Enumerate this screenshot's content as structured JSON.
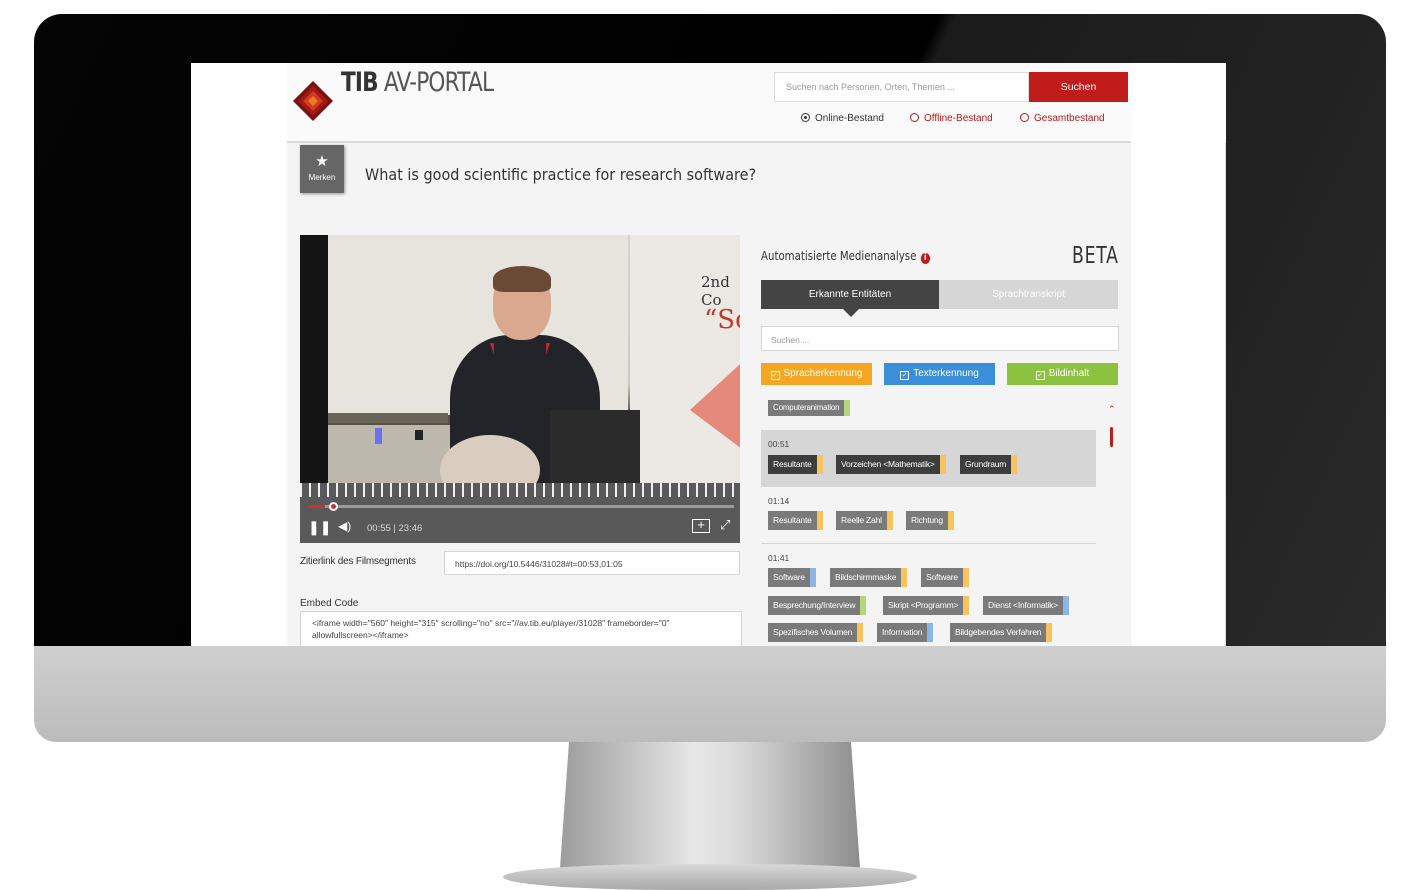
{
  "header": {
    "logo_bold": "TIB",
    "logo_light": "AV-PORTAL",
    "search_placeholder": "Suchen nach Personen, Orten, Themen ...",
    "search_button": "Suchen",
    "scope": [
      "Online-Bestand",
      "Offline-Bestand",
      "Gesamtbestand"
    ],
    "scope_selected": "Online-Bestand"
  },
  "merken": "Merken",
  "title": "What is good scientific practice for research software?",
  "video": {
    "slide_line1": "2nd Co",
    "slide_line2": "“So",
    "time": "00:55 | 23:46",
    "progress": 0.04
  },
  "cite": {
    "label": "Zitierlink des Filmsegments",
    "value": "https://doi.org/10.5446/31028#t=00:53,01:05"
  },
  "embed": {
    "label": "Embed Code",
    "line1": "<iframe width=\"560\" height=\"315\" scrolling=\"no\" src=\"//av.tib.eu/player/31028\" frameborder=\"0\"",
    "line2": "allowfullscreen></iframe>"
  },
  "analysis": {
    "title": "Automatisierte Medienanalyse",
    "badge": "BETA",
    "tabs": [
      "Erkannte Entitäten",
      "Sprachtranskript"
    ],
    "search_placeholder": "Suchen ...",
    "filters": [
      {
        "label": "Spracherkennung",
        "color": "#f5a623"
      },
      {
        "label": "Texterkennung",
        "color": "#3b8fd8"
      },
      {
        "label": "Bildinhalt",
        "color": "#8cc23f"
      }
    ],
    "colors": {
      "speech": "#f6c35c",
      "text": "#8ab6e6",
      "image": "#b6d67a"
    },
    "top_tag": "Computeranimation",
    "segments": [
      {
        "time": "00:51",
        "tags": [
          "Resultante",
          "Vorzeichen <Mathematik>",
          "Grundraum"
        ]
      },
      {
        "time": "01:14",
        "tags": [
          "Resultante",
          "Reelle Zahl",
          "Richtung"
        ]
      },
      {
        "time": "01:41",
        "tags": [
          "Software",
          "Bildschirmmaske",
          "Software",
          "Besprechung/Interview",
          "Skript <Programm>",
          "Dienst <Informatik>",
          "Spezifisches Volumen",
          "Information",
          "Bildgebendes Verfahren"
        ]
      }
    ]
  }
}
